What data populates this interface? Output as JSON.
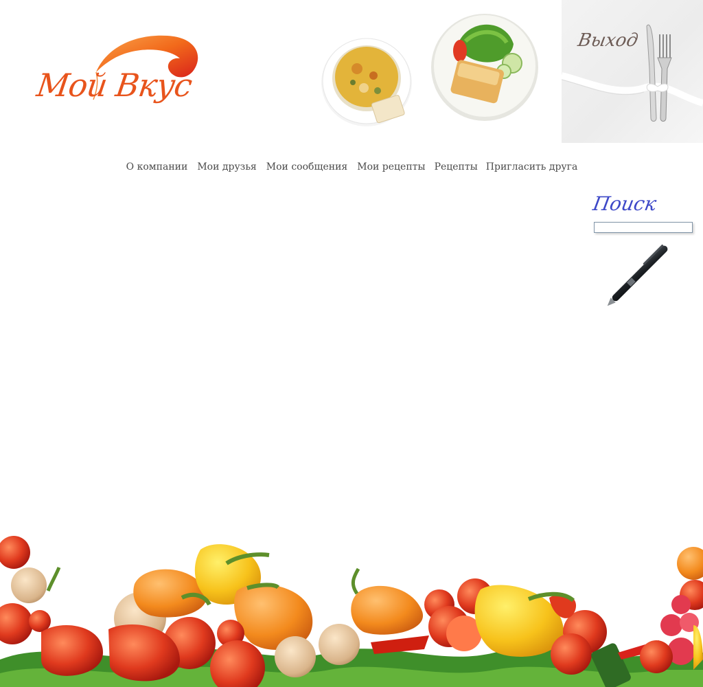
{
  "brand": {
    "logo_text": "Мой Вкус",
    "accent_color": "#e8541c",
    "swoosh_color": "#f26a1b"
  },
  "header": {
    "exit_label": "Выход",
    "dish_images": [
      "soup-bowl-icon",
      "salad-plate-icon"
    ],
    "exit_image": "cutlery-ribbon-icon"
  },
  "nav": {
    "items": [
      {
        "label": "О компании"
      },
      {
        "label": "Мои друзья"
      },
      {
        "label": "Мои сообщения"
      },
      {
        "label": "Мои рецепты"
      },
      {
        "label": "Рецепты"
      },
      {
        "label": "Пригласить друга"
      }
    ]
  },
  "search": {
    "title": "Поиск",
    "placeholder": "",
    "value": "",
    "title_color": "#3d48c8"
  },
  "decor": {
    "pen_icon": "pen-icon",
    "footer_image": "vegetables-icon"
  }
}
